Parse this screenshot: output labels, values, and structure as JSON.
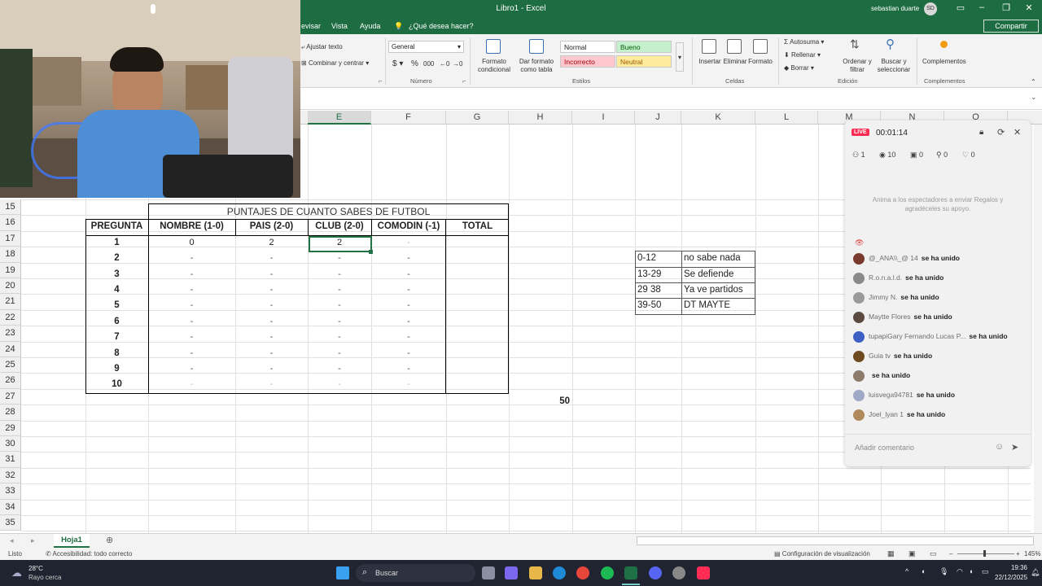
{
  "window": {
    "title": "Libro1 - Excel",
    "user": "sebastian duarte",
    "user_initials": "SD",
    "share_label": "Compartir"
  },
  "menu": {
    "items": [
      "evisar",
      "Vista",
      "Ayuda"
    ],
    "search": "¿Qué desea hacer?"
  },
  "ribbon": {
    "wrap": "Ajustar texto",
    "merge": "Combinar y centrar",
    "number_format": "General",
    "number_group": "Número",
    "cond_format": "Formato condicional",
    "table_format": "Dar formato como tabla",
    "styles": {
      "normal": "Normal",
      "bueno": "Bueno",
      "incorrecto": "Incorrecto",
      "neutral": "Neutral"
    },
    "styles_group": "Estilos",
    "insert": "Insertar",
    "delete": "Eliminar",
    "format": "Formato",
    "cells_group": "Celdas",
    "autosum": "Autosuma",
    "fill": "Rellenar",
    "clear": "Borrar",
    "sort": "Ordenar y filtrar",
    "find": "Buscar y seleccionar",
    "editing_group": "Edición",
    "addins": "Complementos",
    "addins_group": "Complementos"
  },
  "columns": [
    "E",
    "F",
    "G",
    "H",
    "I",
    "J",
    "K",
    "L",
    "M",
    "N",
    "O"
  ],
  "rows": [
    "15",
    "16",
    "17",
    "18",
    "19",
    "20",
    "21",
    "22",
    "23",
    "24",
    "25",
    "26",
    "27",
    "28",
    "29",
    "30",
    "31",
    "32",
    "33",
    "34",
    "35"
  ],
  "table": {
    "title": "PUNTAJES DE CUANTO SABES DE FUTBOL",
    "headers": [
      "PREGUNTA",
      "NOMBRE (1-0)",
      "PAIS (2-0)",
      "CLUB (2-0)",
      "COMODIN (-1)",
      "TOTAL"
    ],
    "rows": [
      [
        "1",
        "0",
        "2",
        "2",
        "-"
      ],
      [
        "2",
        "-",
        "-",
        "-",
        "-"
      ],
      [
        "3",
        "-",
        "-",
        "-",
        "-"
      ],
      [
        "4",
        "-",
        "-",
        "-",
        "-"
      ],
      [
        "5",
        "-",
        "-",
        "-",
        "-"
      ],
      [
        "6",
        "-",
        "-",
        "-",
        "-"
      ],
      [
        "7",
        "-",
        "-",
        "-",
        "-"
      ],
      [
        "8",
        "-",
        "-",
        "-",
        "-"
      ],
      [
        "9",
        "-",
        "-",
        "-",
        "-"
      ],
      [
        "10",
        "-",
        "-",
        "-",
        "-"
      ]
    ],
    "sum": "50"
  },
  "ranges": [
    [
      "0-12",
      "no sabe nada"
    ],
    [
      "13-29",
      "Se defiende"
    ],
    [
      "29 38",
      "Ya ve partidos"
    ],
    [
      "39-50",
      "DT MAYTE"
    ]
  ],
  "live": {
    "badge": "LIVE",
    "timer": "00:01:14",
    "stats": [
      "1",
      "10",
      "0",
      "0",
      "0"
    ],
    "prompt": "Anima a los espectadores a enviar Regalos y agradéceles su apoyo.",
    "chat": [
      {
        "name": "@_ANA\\\\_@ 14",
        "action": "se ha unido",
        "color": "#7a3b2e"
      },
      {
        "name": "R.o.n.a.l.d.",
        "action": "se ha unido",
        "color": "#8a8a8a"
      },
      {
        "name": "Jimmy N.",
        "action": "se ha unido",
        "color": "#9a9a9a"
      },
      {
        "name": "Maytte Flores",
        "action": "se ha unido",
        "color": "#5b4a3f"
      },
      {
        "name": "tupapiGary Fernando Lucas P...",
        "action": "se ha unido",
        "color": "#3d5fc4"
      },
      {
        "name": "Guia tv",
        "action": "se ha unido",
        "color": "#6e4a20"
      },
      {
        "name": "",
        "action": "se ha unido",
        "color": "#8c7a6a"
      },
      {
        "name": "luisvega94781",
        "action": "se ha unido",
        "color": "#9fa8c7"
      },
      {
        "name": "Joel_lyan 1",
        "action": "se ha unido",
        "color": "#b08a5c"
      }
    ],
    "comment_placeholder": "Añadir comentario"
  },
  "sheet_tab": "Hoja1",
  "status": {
    "ready": "Listo",
    "accessibility": "Accesibilidad: todo correcto",
    "display": "Configuración de visualización",
    "zoom": "145%"
  },
  "taskbar": {
    "weather_temp": "28°C",
    "weather_desc": "Rayo cerca",
    "search": "Buscar",
    "time": "19:36",
    "date": "22/12/2025"
  }
}
